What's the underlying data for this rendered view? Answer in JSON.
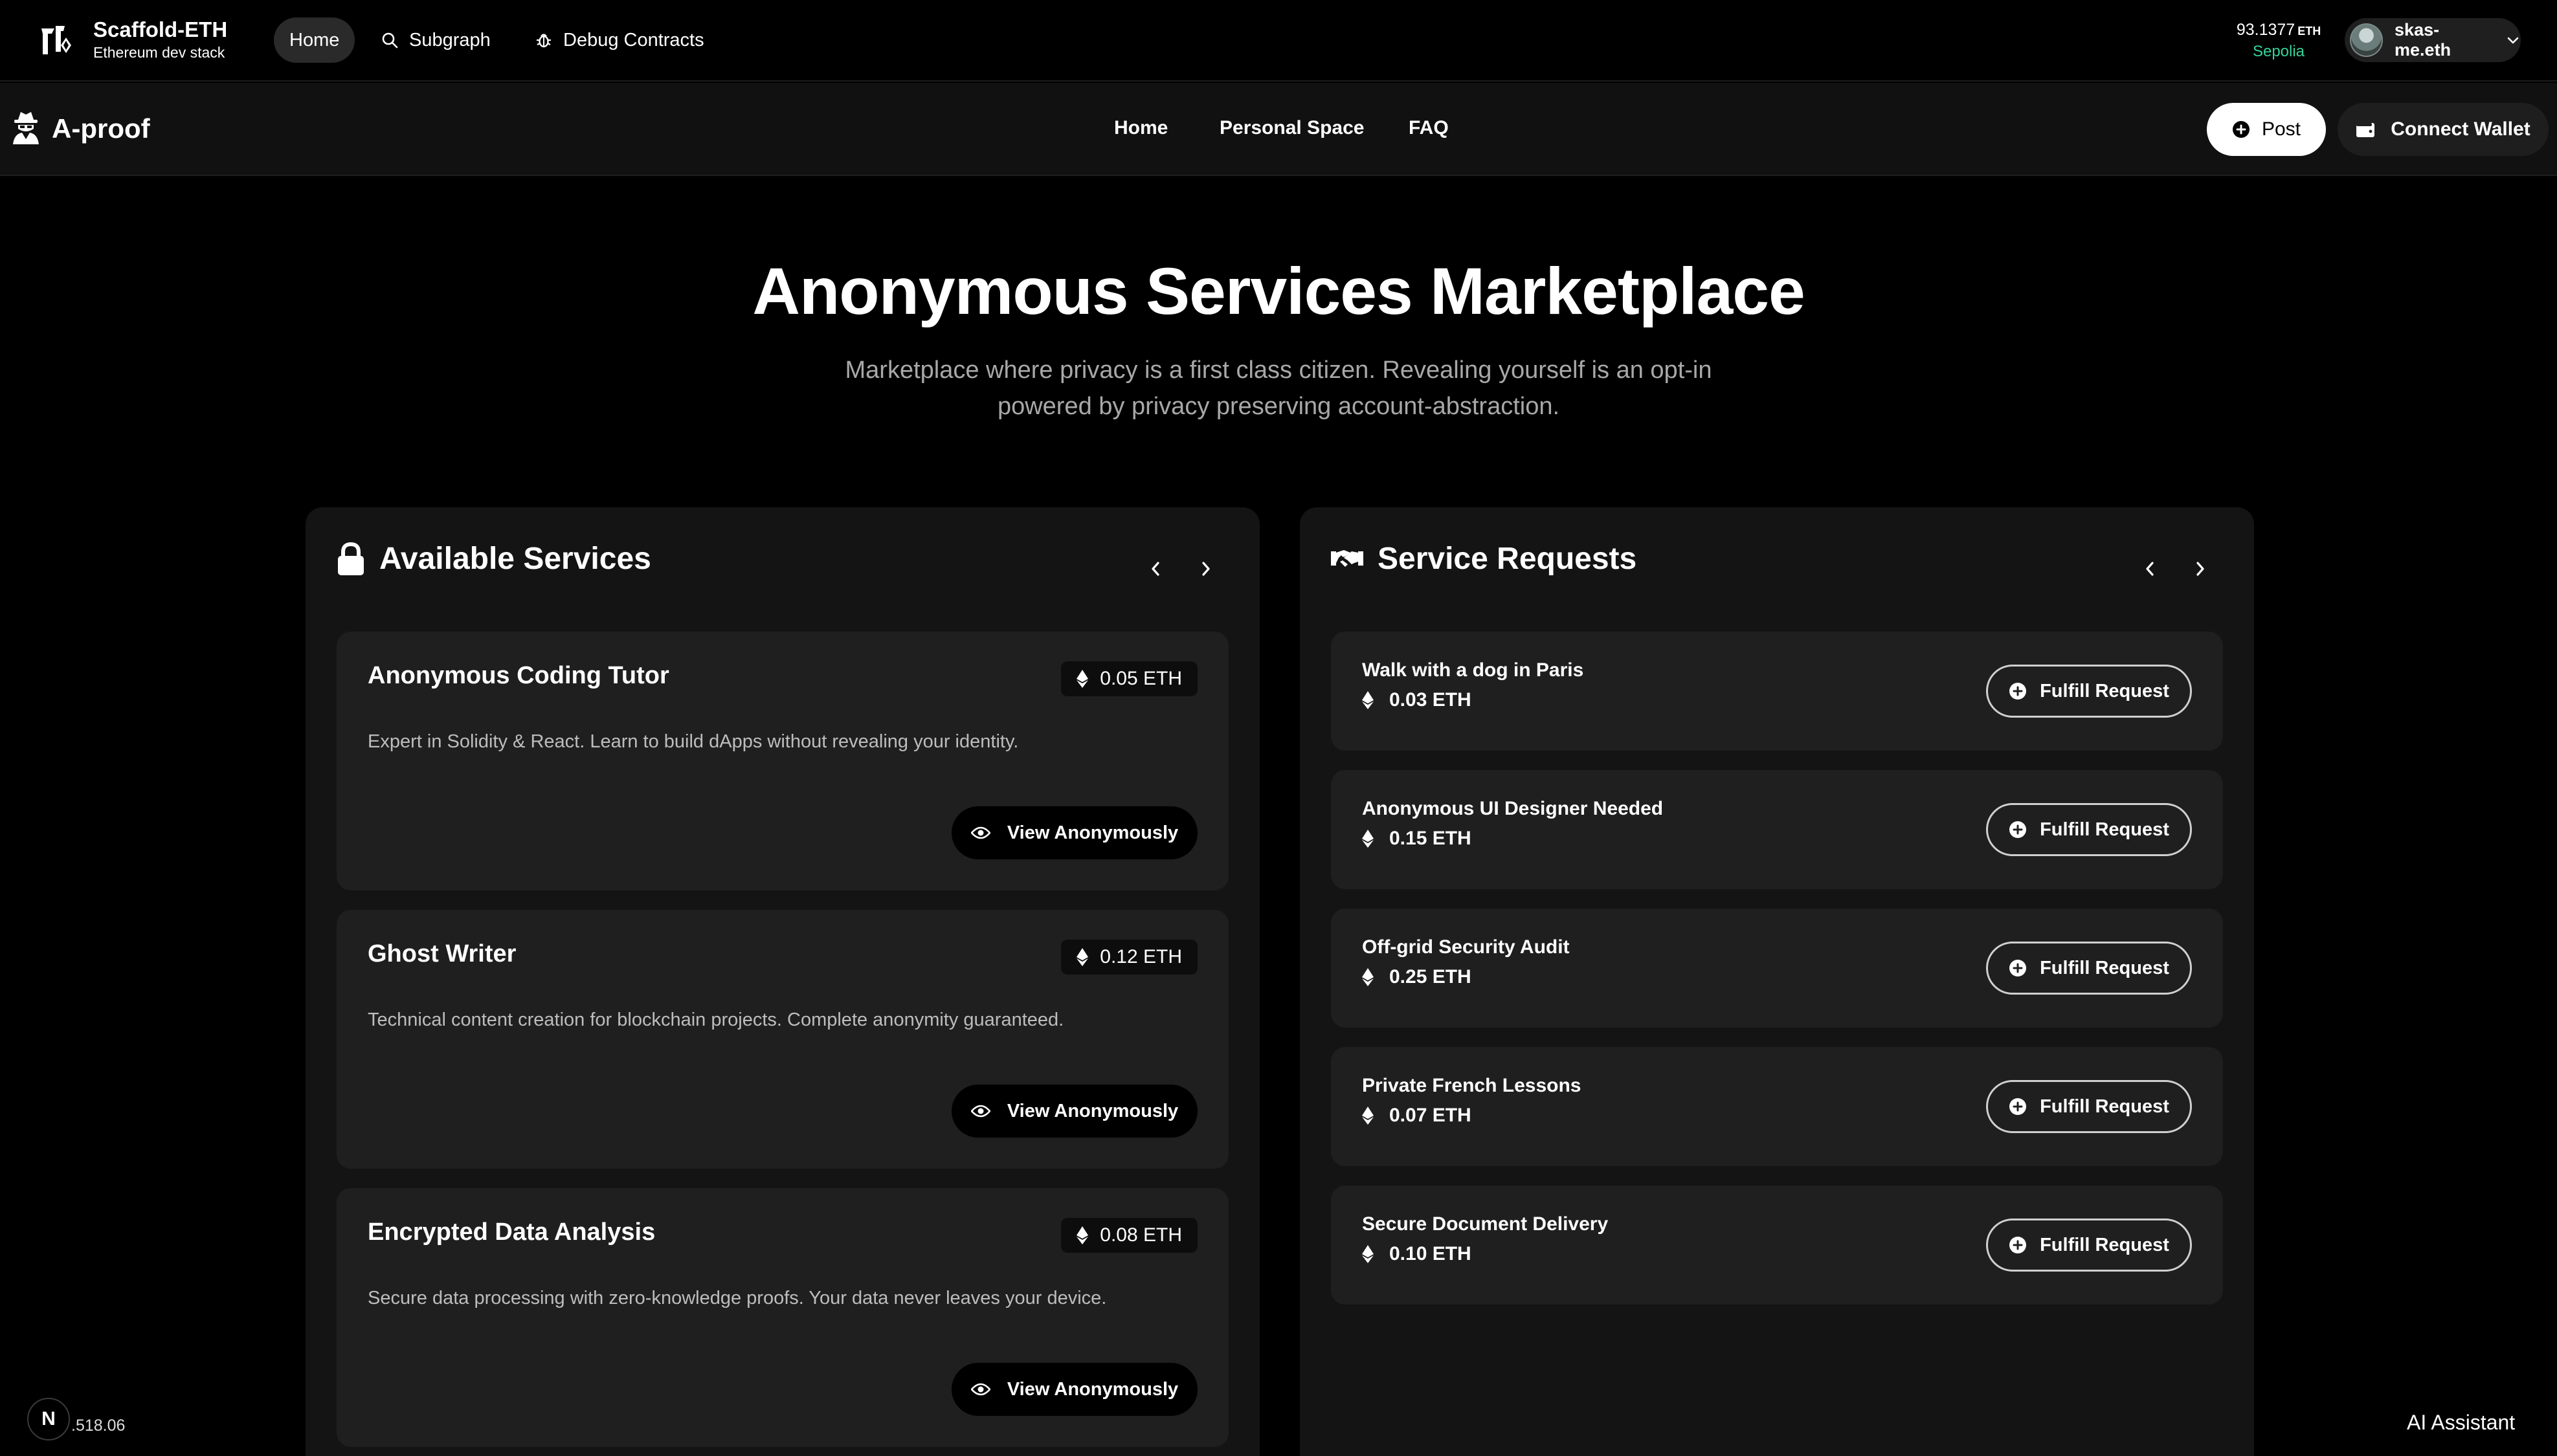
{
  "topbar": {
    "brand_title": "Scaffold-ETH",
    "brand_subtitle": "Ethereum dev stack",
    "nav": [
      {
        "label": "Home",
        "icon": "home",
        "active": true
      },
      {
        "label": "Subgraph",
        "icon": "search-icon"
      },
      {
        "label": "Debug Contracts",
        "icon": "bug-icon"
      }
    ],
    "balance_value": "93.1377",
    "balance_unit": "ETH",
    "network": "Sepolia",
    "account_name": "skas-me.eth"
  },
  "appbar": {
    "app_name": "A-proof",
    "nav": [
      "Home",
      "Personal Space",
      "FAQ"
    ],
    "post_label": "Post",
    "connect_wallet_label": "Connect Wallet"
  },
  "hero": {
    "title": "Anonymous Services Marketplace",
    "subtitle": "Marketplace where privacy is a first class citizen. Revealing yourself is an opt-in powered by privacy preserving account-abstraction."
  },
  "available_services": {
    "title": "Available Services",
    "items": [
      {
        "title": "Anonymous Coding Tutor",
        "price": "0.05 ETH",
        "description": "Expert in Solidity & React. Learn to build dApps without revealing your identity.",
        "action": "View Anonymously"
      },
      {
        "title": "Ghost Writer",
        "price": "0.12 ETH",
        "description": "Technical content creation for blockchain projects. Complete anonymity guaranteed.",
        "action": "View Anonymously"
      },
      {
        "title": "Encrypted Data Analysis",
        "price": "0.08 ETH",
        "description": "Secure data processing with zero-knowledge proofs. Your data never leaves your device.",
        "action": "View Anonymously"
      }
    ]
  },
  "service_requests": {
    "title": "Service Requests",
    "items": [
      {
        "title": "Walk with a dog in Paris",
        "price": "0.03 ETH",
        "action": "Fulfill Request"
      },
      {
        "title": "Anonymous UI Designer Needed",
        "price": "0.15 ETH",
        "action": "Fulfill Request"
      },
      {
        "title": "Off-grid Security Audit",
        "price": "0.25 ETH",
        "action": "Fulfill Request"
      },
      {
        "title": "Private French Lessons",
        "price": "0.07 ETH",
        "action": "Fulfill Request"
      },
      {
        "title": "Secure Document Delivery",
        "price": "0.10 ETH",
        "action": "Fulfill Request"
      }
    ]
  },
  "footer": {
    "next_badge": "N",
    "version": ".518.06",
    "ai_assistant": "AI Assistant"
  },
  "colors": {
    "background": "#000000",
    "panel": "#141414",
    "card": "#1f1f1f",
    "network_green": "#34d399",
    "muted_text": "#a8a8a8"
  }
}
